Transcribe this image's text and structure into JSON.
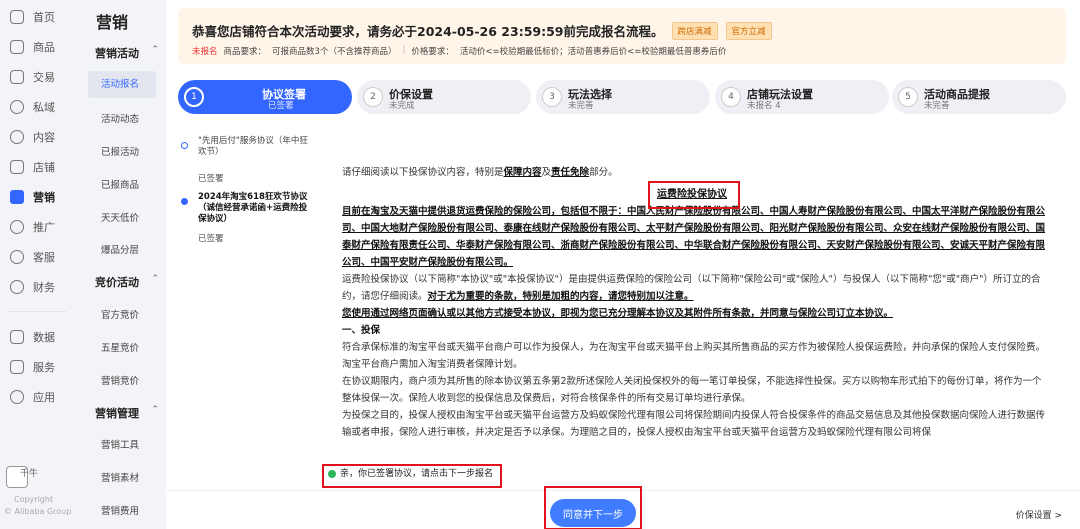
{
  "rail": {
    "items": [
      {
        "label": "首页",
        "icon": "home-icon"
      },
      {
        "label": "商品",
        "icon": "goods-icon"
      },
      {
        "label": "交易",
        "icon": "trade-icon"
      },
      {
        "label": "私域",
        "icon": "private-icon"
      },
      {
        "label": "内容",
        "icon": "content-icon"
      },
      {
        "label": "店铺",
        "icon": "store-icon"
      },
      {
        "label": "营销",
        "icon": "marketing-icon"
      },
      {
        "label": "推广",
        "icon": "promote-icon"
      },
      {
        "label": "客服",
        "icon": "service-icon"
      },
      {
        "label": "财务",
        "icon": "finance-icon"
      },
      {
        "label": "数据",
        "icon": "data-icon"
      },
      {
        "label": "服务",
        "icon": "services-icon"
      },
      {
        "label": "应用",
        "icon": "apps-icon"
      }
    ],
    "brand": "千牛",
    "copyright": "Copyright",
    "copyright_line2": "© Alibaba Group"
  },
  "submenu": {
    "title": "营销",
    "groups": [
      {
        "label": "营销活动",
        "items": [
          "活动报名",
          "活动动态",
          "已报活动",
          "已报商品",
          "天天低价",
          "爆品分层"
        ]
      },
      {
        "label": "竞价活动",
        "items": [
          "官方竞价",
          "五星竞价",
          "营销竞价"
        ]
      },
      {
        "label": "营销管理",
        "items": [
          "营销工具",
          "营销素材",
          "营销费用"
        ]
      }
    ]
  },
  "notice": {
    "title": "恭喜您店铺符合本次活动要求，请务必于2024-05-26 23:59:59前完成报名流程。",
    "tags": [
      "跨店满减",
      "官方立减"
    ],
    "status": "未报名",
    "goods_req": "商品要求：",
    "goods_req_val": "可报商品数3个（不含推荐商品）",
    "price_req": "价格要求：",
    "price_req_val": "活动价<=校验期最低标价；活动普惠券后价<=校验期最低普惠券后价"
  },
  "steps": [
    {
      "num": "1",
      "label": "协议签署",
      "status": "已签署"
    },
    {
      "num": "2",
      "label": "价保设置",
      "status": "未完成"
    },
    {
      "num": "3",
      "label": "玩法选择",
      "status": "未完善"
    },
    {
      "num": "4",
      "label": "店铺玩法设置",
      "status": "未报名 4"
    },
    {
      "num": "5",
      "label": "活动商品提报",
      "status": "未完善"
    }
  ],
  "agreements": [
    {
      "title": "\"先用后付\"服务协议（年中狂欢节）",
      "status": "已签署"
    },
    {
      "title": "2024年淘宝618狂欢节协议（诚信经营承诺函+运费险投保协议）",
      "status": "已签署"
    }
  ],
  "content": {
    "intro_a": "请仔细阅读以下投保协议内容，特别是",
    "intro_b": "保障内容",
    "intro_c": "及",
    "intro_d": "责任免除",
    "intro_e": "部分。",
    "doc_title": "运费险投保协议",
    "insurers": "目前在淘宝及天猫中提供退货运费保险的保险公司，包括但不限于：中国人民财产保险股份有限公司、中国人寿财产保险股份有限公司、中国太平洋财产保险股份有限公司、中国大地财产保险股份有限公司、泰康在线财产保险股份有限公司、太平财产保险股份有限公司、阳光财产保险股份有限公司、众安在线财产保险股份有限公司、国泰财产保险有限责任公司、华泰财产保险有限公司、浙商财产保险股份有限公司、中华联合财产保险股份有限公司、天安财产保险股份有限公司、安诚天平财产保险有限公司、中国平安财产保险股份有限公司。",
    "p2a": "运费险投保协议（以下简称\"本协议\"或\"本投保协议\"）是由提供运费保险的保险公司（以下简称\"保险公司\"或\"保险人\"）与投保人（以下简称\"您\"或\"商户\"）所订立的合约，请您仔细阅读。",
    "p2b": "对于尤为重要的条款，特别是加粗的内容，请您特别加以注意。",
    "p3": "您使用通过网络页面确认或以其他方式接受本协议，即视为您已充分理解本协议及其附件所有条款，并同意与保险公司订立本协议。",
    "h1": "一、投保",
    "p4": "符合承保标准的淘宝平台或天猫平台商户可以作为投保人，为在淘宝平台或天猫平台上购买其所售商品的买方作为被保险人投保运费险，并向承保的保险人支付保险费。淘宝平台商户需加入淘宝消费者保障计划。",
    "p5": "在协议期限内，商户须为其所售的除本协议第五条第2款所述保险人关闭投保权外的每一笔订单投保，不能选择性投保。买方以购物车形式拍下的每份订单，将作为一个整体投保一次。保险人收到您的投保信息及保费后，对符合核保条件的所有交易订单均进行承保。",
    "p6": "为投保之目的，投保人授权由淘宝平台或天猫平台运营方及蚂蚁保险代理有限公司将保险期间内投保人符合投保条件的商品交易信息及其他投保数据向保险人进行数据传输或者申报，保险人进行审核，并决定是否予以承保。为理赔之目的，投保人授权由淘宝平台或天猫平台运营方及蚂蚁保险代理有限公司将保"
  },
  "signed_msg": "亲，你已签署协议，请点击下一步报名",
  "next_button": "同意并下一步",
  "footer_right": "价保设置 >",
  "colors": {
    "accent": "#3366ff",
    "highlight": "#e0131a",
    "notice_bg": "#fff6e9"
  }
}
